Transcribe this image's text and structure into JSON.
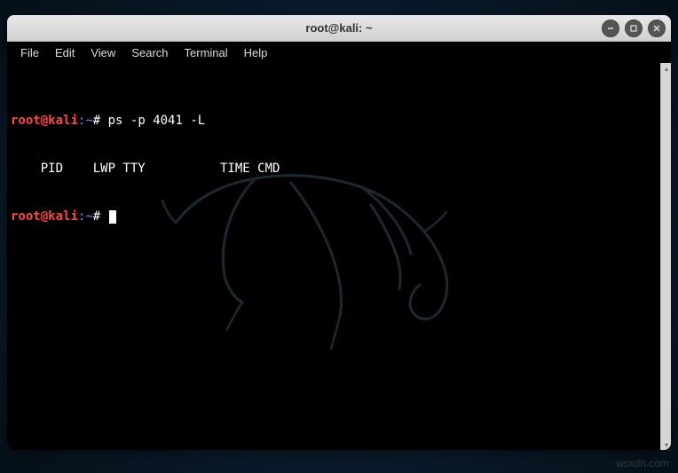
{
  "window": {
    "title": "root@kali: ~"
  },
  "menubar": {
    "file": "File",
    "edit": "Edit",
    "view": "View",
    "search": "Search",
    "terminal": "Terminal",
    "help": "Help"
  },
  "prompt": {
    "user": "root",
    "at": "@",
    "host": "kali",
    "colon": ":",
    "path": "~",
    "hash": "#"
  },
  "lines": {
    "cmd1": " ps -p 4041 -L",
    "out1": "    PID    LWP TTY          TIME CMD"
  },
  "watermark": "wsxdn.com"
}
